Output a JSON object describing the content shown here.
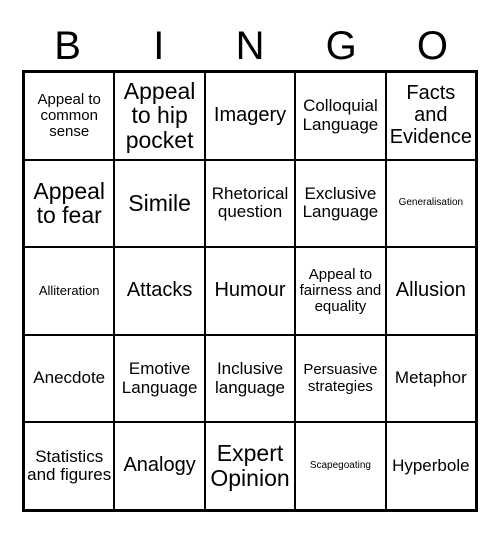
{
  "header": {
    "letters": [
      "B",
      "I",
      "N",
      "G",
      "O"
    ]
  },
  "grid": {
    "rows": [
      [
        {
          "text": "Appeal to common sense",
          "size": "sm"
        },
        {
          "text": "Appeal to hip pocket",
          "size": "xl"
        },
        {
          "text": "Imagery",
          "size": "lg"
        },
        {
          "text": "Colloquial Language",
          "size": "md"
        },
        {
          "text": "Facts and Evidence",
          "size": "lg"
        }
      ],
      [
        {
          "text": "Appeal to fear",
          "size": "xl"
        },
        {
          "text": "Simile",
          "size": "xl"
        },
        {
          "text": "Rhetorical question",
          "size": "md"
        },
        {
          "text": "Exclusive Language",
          "size": "md"
        },
        {
          "text": "Generalisation",
          "size": "xxs"
        }
      ],
      [
        {
          "text": "Alliteration",
          "size": "xs"
        },
        {
          "text": "Attacks",
          "size": "lg"
        },
        {
          "text": "Humour",
          "size": "lg"
        },
        {
          "text": "Appeal to fairness and equality",
          "size": "sm"
        },
        {
          "text": "Allusion",
          "size": "lg"
        }
      ],
      [
        {
          "text": "Anecdote",
          "size": "md"
        },
        {
          "text": "Emotive Language",
          "size": "md"
        },
        {
          "text": "Inclusive language",
          "size": "md"
        },
        {
          "text": "Persuasive strategies",
          "size": "sm"
        },
        {
          "text": "Metaphor",
          "size": "md"
        }
      ],
      [
        {
          "text": "Statistics and figures",
          "size": "md"
        },
        {
          "text": "Analogy",
          "size": "lg"
        },
        {
          "text": "Expert Opinion",
          "size": "xl"
        },
        {
          "text": "Scapegoating",
          "size": "xxs"
        },
        {
          "text": "Hyperbole",
          "size": "md"
        }
      ]
    ]
  }
}
